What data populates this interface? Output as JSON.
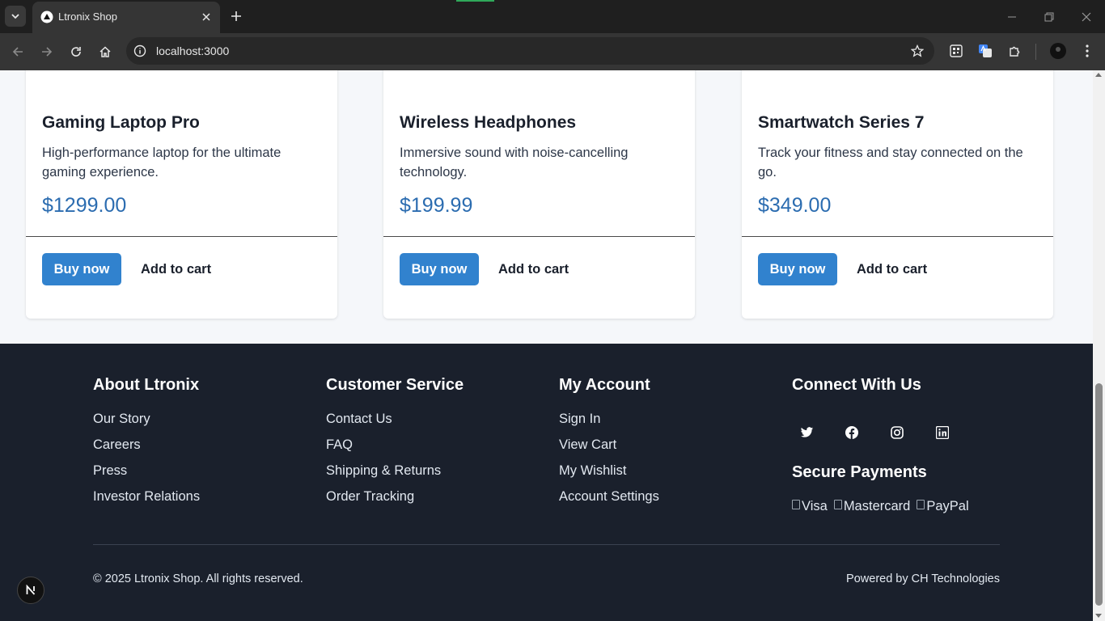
{
  "browser": {
    "tab_title": "Ltronix Shop",
    "url": "localhost:3000",
    "icons": [
      "tab-list-icon",
      "tab-favicon-icon",
      "close-icon",
      "plus-icon",
      "minimize-icon",
      "restore-icon",
      "back-icon",
      "forward-icon",
      "reload-icon",
      "home-icon",
      "site-info-icon",
      "bookmark-star-icon",
      "qr-code-icon",
      "translate-icon",
      "extensions-icon",
      "profile-avatar-icon",
      "menu-kebab-icon"
    ]
  },
  "products": [
    {
      "name": "Gaming Laptop Pro",
      "description": "High-performance laptop for the ultimate gaming experience.",
      "price": "$1299.00",
      "buy_label": "Buy now",
      "cart_label": "Add to cart"
    },
    {
      "name": "Wireless Headphones",
      "description": "Immersive sound with noise-cancelling technology.",
      "price": "$199.99",
      "buy_label": "Buy now",
      "cart_label": "Add to cart"
    },
    {
      "name": "Smartwatch Series 7",
      "description": "Track your fitness and stay connected on the go.",
      "price": "$349.00",
      "buy_label": "Buy now",
      "cart_label": "Add to cart"
    }
  ],
  "footer": {
    "columns": [
      {
        "heading": "About Ltronix",
        "links": [
          "Our Story",
          "Careers",
          "Press",
          "Investor Relations"
        ]
      },
      {
        "heading": "Customer Service",
        "links": [
          "Contact Us",
          "FAQ",
          "Shipping & Returns",
          "Order Tracking"
        ]
      },
      {
        "heading": "My Account",
        "links": [
          "Sign In",
          "View Cart",
          "My Wishlist",
          "Account Settings"
        ]
      }
    ],
    "connect_heading": "Connect With Us",
    "social_icons": [
      "twitter-icon",
      "facebook-icon",
      "instagram-icon",
      "linkedin-icon"
    ],
    "secure_heading": "Secure Payments",
    "payments": [
      "Visa",
      "Mastercard",
      "PayPal"
    ],
    "copyright": "© 2025 Ltronix Shop. All rights reserved.",
    "powered_by": "Powered by CH Technologies"
  },
  "colors": {
    "accent": "#3182ce",
    "price": "#2b6cb0",
    "footer_bg": "#1a202c",
    "page_bg": "#f5f7fa"
  }
}
